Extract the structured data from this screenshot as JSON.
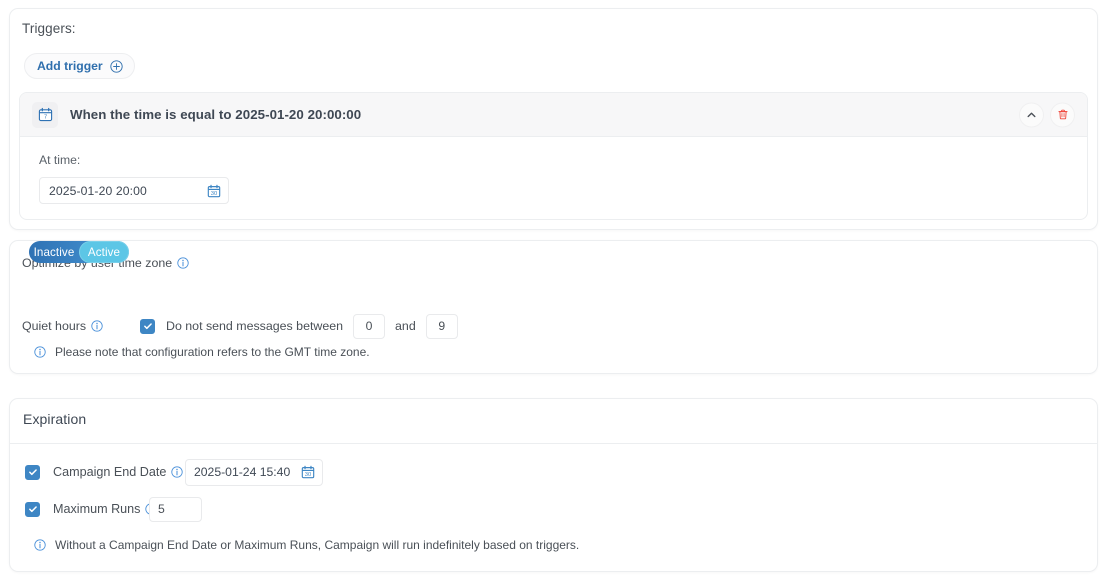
{
  "triggers_section": {
    "label": "Triggers:",
    "add_button": {
      "label": "Add trigger",
      "icon": "plus-circle-icon"
    },
    "trigger": {
      "icon": "calendar-icon",
      "title": "When the time is equal to 2025-01-20 20:00:00",
      "collapse_icon": "chevron-up-icon",
      "delete_icon": "trash-icon",
      "field_label": "At time:",
      "field_value": "2025-01-20 20:00",
      "field_icon": "calendar-picker-icon"
    }
  },
  "optimize_section": {
    "label": "Optimize by user time zone",
    "info_icon": "info-icon",
    "toggle": {
      "inactive_label": "Inactive",
      "active_label": "Active",
      "selected": "Active"
    },
    "quiet_hours": {
      "label": "Quiet hours",
      "info_icon": "info-icon",
      "checked": true,
      "text": "Do not send messages between",
      "from": "0",
      "conjunction": "and",
      "to": "9"
    },
    "note": "Please note that configuration refers to the GMT time zone.",
    "note_icon": "info-icon"
  },
  "expiration_section": {
    "title": "Expiration",
    "campaign_end_date": {
      "checked": true,
      "label": "Campaign End Date",
      "info_icon": "info-icon",
      "value": "2025-01-24 15:40",
      "field_icon": "calendar-picker-icon"
    },
    "maximum_runs": {
      "checked": true,
      "label": "Maximum Runs",
      "info_icon": "info-icon",
      "value": "5"
    },
    "note": "Without a Campaign End Date or Maximum Runs, Campaign will run indefinitely based on triggers.",
    "note_icon": "info-icon"
  },
  "colors": {
    "accent_blue": "#3e86c4",
    "link_blue": "#2f6fad",
    "toggle_active": "#5cc6e6",
    "toggle_base": "#2f72b4",
    "danger_red": "#f04438",
    "text": "#4a5057",
    "border": "#eceef0"
  }
}
